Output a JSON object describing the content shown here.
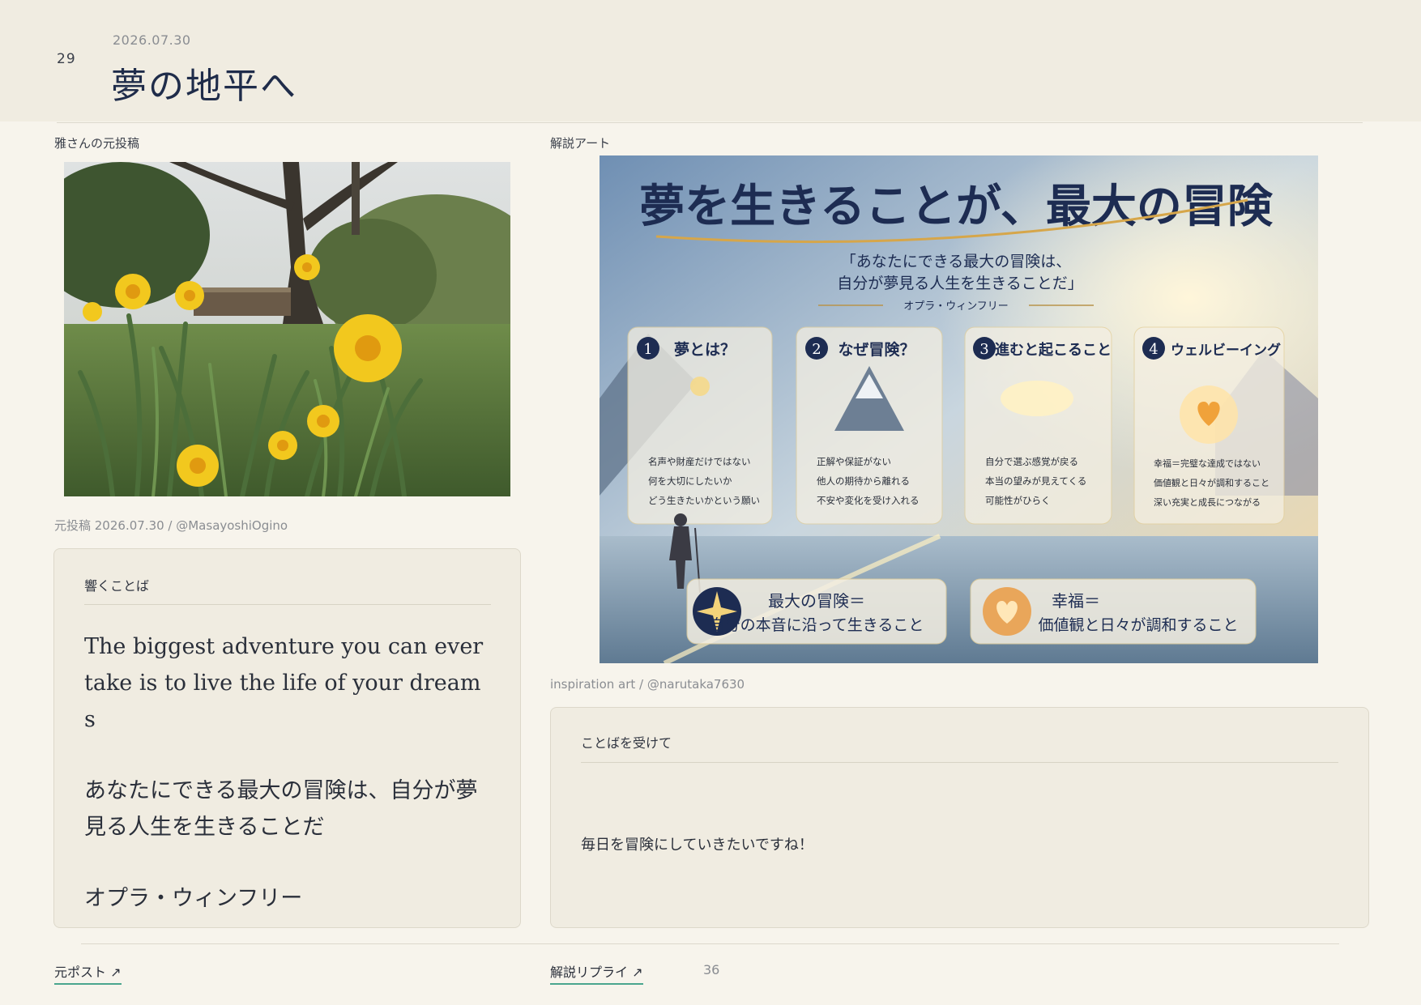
{
  "header": {
    "page_number": "29",
    "date": "2026.07.30",
    "title": "夢の地平へ"
  },
  "left": {
    "section_label": "雅さんの元投稿",
    "photo_caption": "元投稿 2026.07.30 / @MasayoshiOgino",
    "quote_card": {
      "title": "響くことば",
      "english": "The biggest adventure you can ever take is to live the life of your dreams",
      "japanese": "あなたにできる最大の冒険は、自分が夢見る人生を生きることだ",
      "author": "オプラ・ウィンフリー"
    }
  },
  "right": {
    "section_label": "解説アート",
    "art": {
      "headline": "夢を生きることが、最大の冒険",
      "quote_line1": "「あなたにできる最大の冒険は、",
      "quote_line2": "自分が夢見る人生を生きることだ」",
      "quote_author": "オプラ・ウィンフリー",
      "panels": [
        {
          "num": "1",
          "title": "夢とは？",
          "items": [
            "名声や財産だけではない",
            "何を大切にしたいか",
            "どう生きたいかという願い"
          ]
        },
        {
          "num": "2",
          "title": "なぜ冒険？",
          "items": [
            "正解や保証がない",
            "他人の期待から離れる",
            "不安や変化を受け入れる"
          ]
        },
        {
          "num": "3",
          "title": "進むと起こること",
          "items": [
            "自分で選ぶ感覚が戻る",
            "本当の望みが見えてくる",
            "可能性がひらく"
          ]
        },
        {
          "num": "4",
          "title": "ウェルビーイング",
          "items": [
            "幸福＝完璧な達成ではない",
            "価値観と日々が調和すること",
            "深い充実と成長につながる"
          ]
        }
      ],
      "bottom_left_line1": "最大の冒険＝",
      "bottom_left_line2": "自分の本音に沿って生きること",
      "bottom_right_line1": "幸福＝",
      "bottom_right_line2": "価値観と日々が調和すること"
    },
    "art_caption": "inspiration art / @narutaka7630",
    "response_card": {
      "title": "ことばを受けて",
      "text": "毎日を冒険にしていきたいですね！"
    }
  },
  "footer": {
    "original_post_link": "元ポスト ↗",
    "reply_link": "解説リプライ ↗",
    "count": "36"
  }
}
